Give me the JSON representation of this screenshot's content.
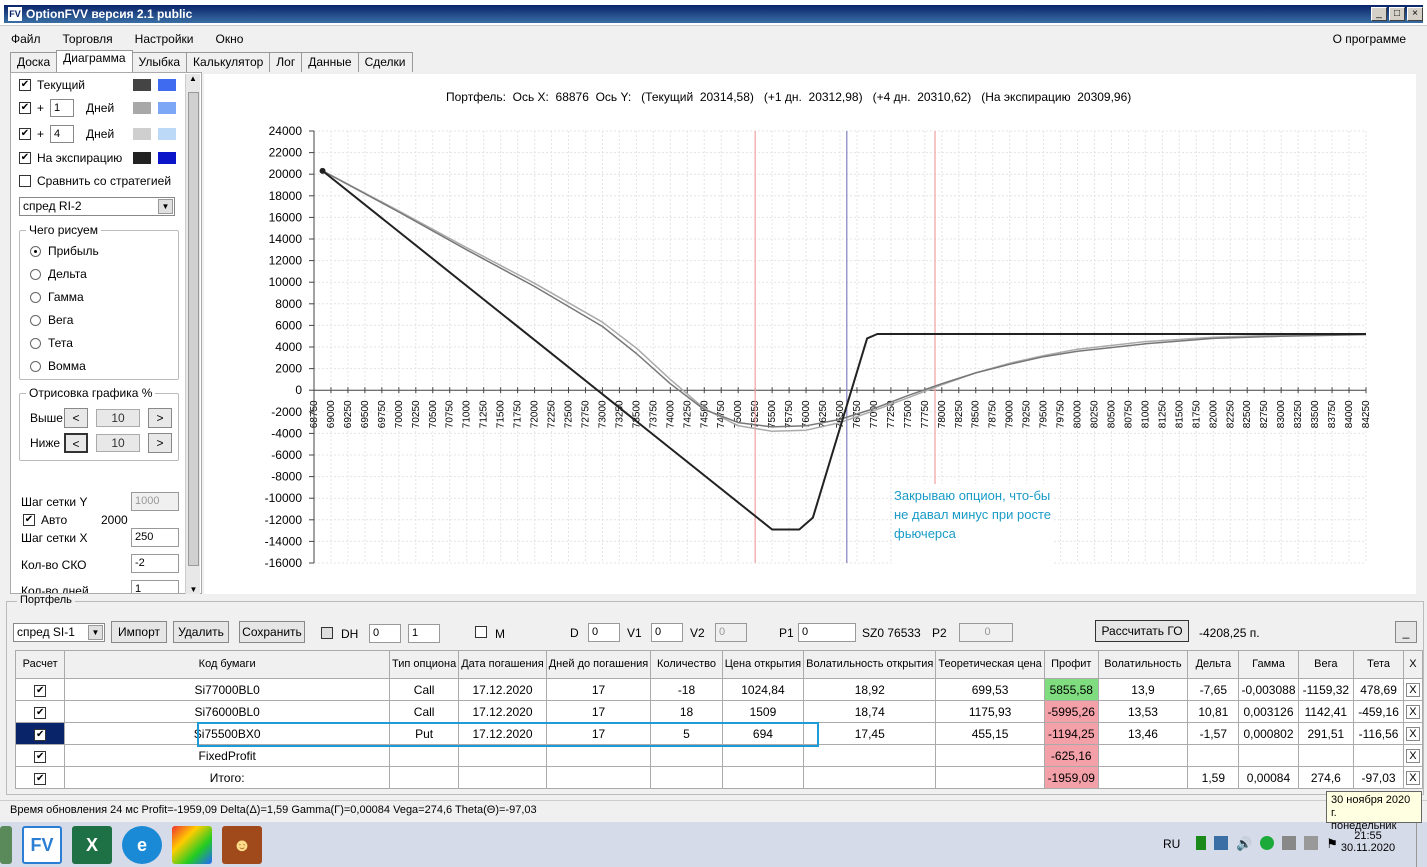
{
  "window": {
    "title": "OptionFVV версия 2.1 public",
    "icon": "app-icon"
  },
  "menu": [
    "Файл",
    "Торговля",
    "Настройки",
    "Окно"
  ],
  "menu_about": "О программе",
  "tabs": [
    "Доска",
    "Диаграмма",
    "Улыбка",
    "Калькулятор",
    "Лог",
    "Данные",
    "Сделки"
  ],
  "left": {
    "current": "Текущий",
    "plus": "+",
    "days": "Дней",
    "day1": "1",
    "day2": "4",
    "expiry": "На экспирацию",
    "compare": "Сравнить со стратегией",
    "strategy": "спред RI-2",
    "draw_group": "Чего рисуем",
    "radios": [
      "Прибыль",
      "Дельта",
      "Гамма",
      "Вега",
      "Тета",
      "Вомма"
    ],
    "render_group": "Отрисовка графика %",
    "above": "Выше",
    "below": "Ниже",
    "above_val": "10",
    "below_val": "10",
    "grid_y_label": "Шаг сетки Y",
    "grid_y_val": "1000",
    "auto": "Авто",
    "auto_val": "2000",
    "grid_x_label": "Шаг сетки X",
    "grid_x_val": "250",
    "sko_label": "Кол-во СКО",
    "sko_val": "-2",
    "days_label": "Кол-во дней",
    "days_val": "1"
  },
  "chart_header": "Портфель:  Ось X:  68876  Ось Y:   (Текущий  20314,58)   (+1 дн.  20312,98)   (+4 дн.  20310,62)   (На экспирацию  20309,96)",
  "annotation": "Закрываю опцион, что-бы не давал минус при росте фьючерса",
  "chart_data": {
    "type": "line",
    "title": "",
    "xlim": [
      68750,
      84250
    ],
    "ylim": [
      -16000,
      24000
    ],
    "x_step": 250,
    "y_step": 2000,
    "grid": true,
    "vlines": [
      {
        "x": 75250,
        "color": "#f4a0a0"
      },
      {
        "x": 76600,
        "color": "#8080c0"
      },
      {
        "x": 77900,
        "color": "#f4a0a0"
      }
    ],
    "series": [
      {
        "color": "#222222",
        "points": [
          [
            68876,
            20310
          ],
          [
            75500,
            -12900
          ],
          [
            75900,
            -12900
          ],
          [
            76100,
            -11800
          ],
          [
            76900,
            4800
          ],
          [
            77050,
            5200
          ],
          [
            84250,
            5200
          ]
        ]
      },
      {
        "color": "#aaaaaa",
        "points": [
          [
            68876,
            20314
          ],
          [
            70000,
            16600
          ],
          [
            71000,
            13200
          ],
          [
            72000,
            9900
          ],
          [
            73000,
            6300
          ],
          [
            73500,
            3900
          ],
          [
            74000,
            1000
          ],
          [
            74500,
            -1700
          ],
          [
            75000,
            -3300
          ],
          [
            75500,
            -3800
          ],
          [
            76000,
            -3700
          ],
          [
            76500,
            -3000
          ],
          [
            77000,
            -1900
          ],
          [
            77500,
            -700
          ],
          [
            78000,
            500
          ],
          [
            78500,
            1600
          ],
          [
            79000,
            2500
          ],
          [
            79500,
            3200
          ],
          [
            80000,
            3800
          ],
          [
            81000,
            4500
          ],
          [
            82000,
            4900
          ],
          [
            83000,
            5100
          ],
          [
            84250,
            5200
          ]
        ]
      },
      {
        "color": "#777777",
        "points": [
          [
            68876,
            20310
          ],
          [
            70000,
            16500
          ],
          [
            71000,
            13000
          ],
          [
            72000,
            9600
          ],
          [
            73000,
            5900
          ],
          [
            73500,
            3400
          ],
          [
            74000,
            600
          ],
          [
            74500,
            -1800
          ],
          [
            75000,
            -3000
          ],
          [
            75500,
            -3400
          ],
          [
            76000,
            -3300
          ],
          [
            76500,
            -2700
          ],
          [
            77000,
            -1700
          ],
          [
            77500,
            -500
          ],
          [
            78000,
            600
          ],
          [
            78500,
            1600
          ],
          [
            79000,
            2400
          ],
          [
            79500,
            3100
          ],
          [
            80000,
            3600
          ],
          [
            81000,
            4300
          ],
          [
            82000,
            4800
          ],
          [
            83000,
            5000
          ],
          [
            84250,
            5150
          ]
        ]
      }
    ]
  },
  "portfolio": {
    "title": "Портфель",
    "portfolio_combo": "спред SI-1",
    "btn_import": "Импорт",
    "btn_delete": "Удалить",
    "btn_save": "Сохранить",
    "dh": "DH",
    "dh1": "0",
    "dh2": "1",
    "m": "M",
    "d": "D",
    "d_val": "0",
    "v1": "V1",
    "v1_val": "0",
    "v2": "V2",
    "v2_val": "0",
    "p1": "P1",
    "p1_val": "0",
    "sz": "SZ0 76533",
    "p2": "P2",
    "p2_val": "0",
    "calc_go": "Рассчитать ГО",
    "go_val": "-4208,25 п.",
    "minimize": "_",
    "headers": [
      "Расчет",
      "Код бумаги",
      "Тип опциона",
      "Дата погашения",
      "Дней до погашения",
      "Количество",
      "Цена открытия",
      "Волатильность открытия",
      "Теоретическая цена",
      "Профит",
      "Волатильность",
      "Дельта",
      "Гамма",
      "Вега",
      "Тета",
      "X"
    ],
    "rows": [
      [
        "✔",
        "Si77000BL0",
        "Call",
        "17.12.2020",
        "17",
        "-18",
        "1024,84",
        "18,92",
        "699,53",
        "5855,58",
        "13,9",
        "-7,65",
        "-0,003088",
        "-1159,32",
        "478,69",
        "X"
      ],
      [
        "✔",
        "Si76000BL0",
        "Call",
        "17.12.2020",
        "17",
        "18",
        "1509",
        "18,74",
        "1175,93",
        "-5995,26",
        "13,53",
        "10,81",
        "0,003126",
        "1142,41",
        "-459,16",
        "X"
      ],
      [
        "✔",
        "Si75500BX0",
        "Put",
        "17.12.2020",
        "17",
        "5",
        "694",
        "17,45",
        "455,15",
        "-1194,25",
        "13,46",
        "-1,57",
        "0,000802",
        "291,51",
        "-116,56",
        "X"
      ],
      [
        "✔",
        "FixedProfit",
        "",
        "",
        "",
        "",
        "",
        "",
        "",
        "-625,16",
        "",
        "",
        "",
        "",
        "",
        "X"
      ],
      [
        "✔",
        "Итого:",
        "",
        "",
        "",
        "",
        "",
        "",
        "",
        "-1959,09",
        "",
        "1,59",
        "0,00084",
        "274,6",
        "-97,03",
        "X"
      ]
    ],
    "profit_colors": [
      "#7fdc7f",
      "#f4a0a8",
      "#f4a0a8",
      "#f4a0a8",
      "#f4a0a8"
    ]
  },
  "status": "Время обновления 24 мс  Profit=-1959,09 Delta(Δ)=1,59 Gamma(Γ)=0,00084 Vega=274,6 Theta(Θ)=-97,03",
  "taskbar": {
    "lang": "RU",
    "time": "21:55",
    "date": "30.11.2020",
    "tooltip1": "30 ноября 2020 г.",
    "tooltip2": "понедельник",
    "apps": [
      "windows-icon",
      "optionfvv-icon",
      "excel-icon",
      "edge-icon",
      "rubik-icon",
      "avatar-icon"
    ]
  }
}
